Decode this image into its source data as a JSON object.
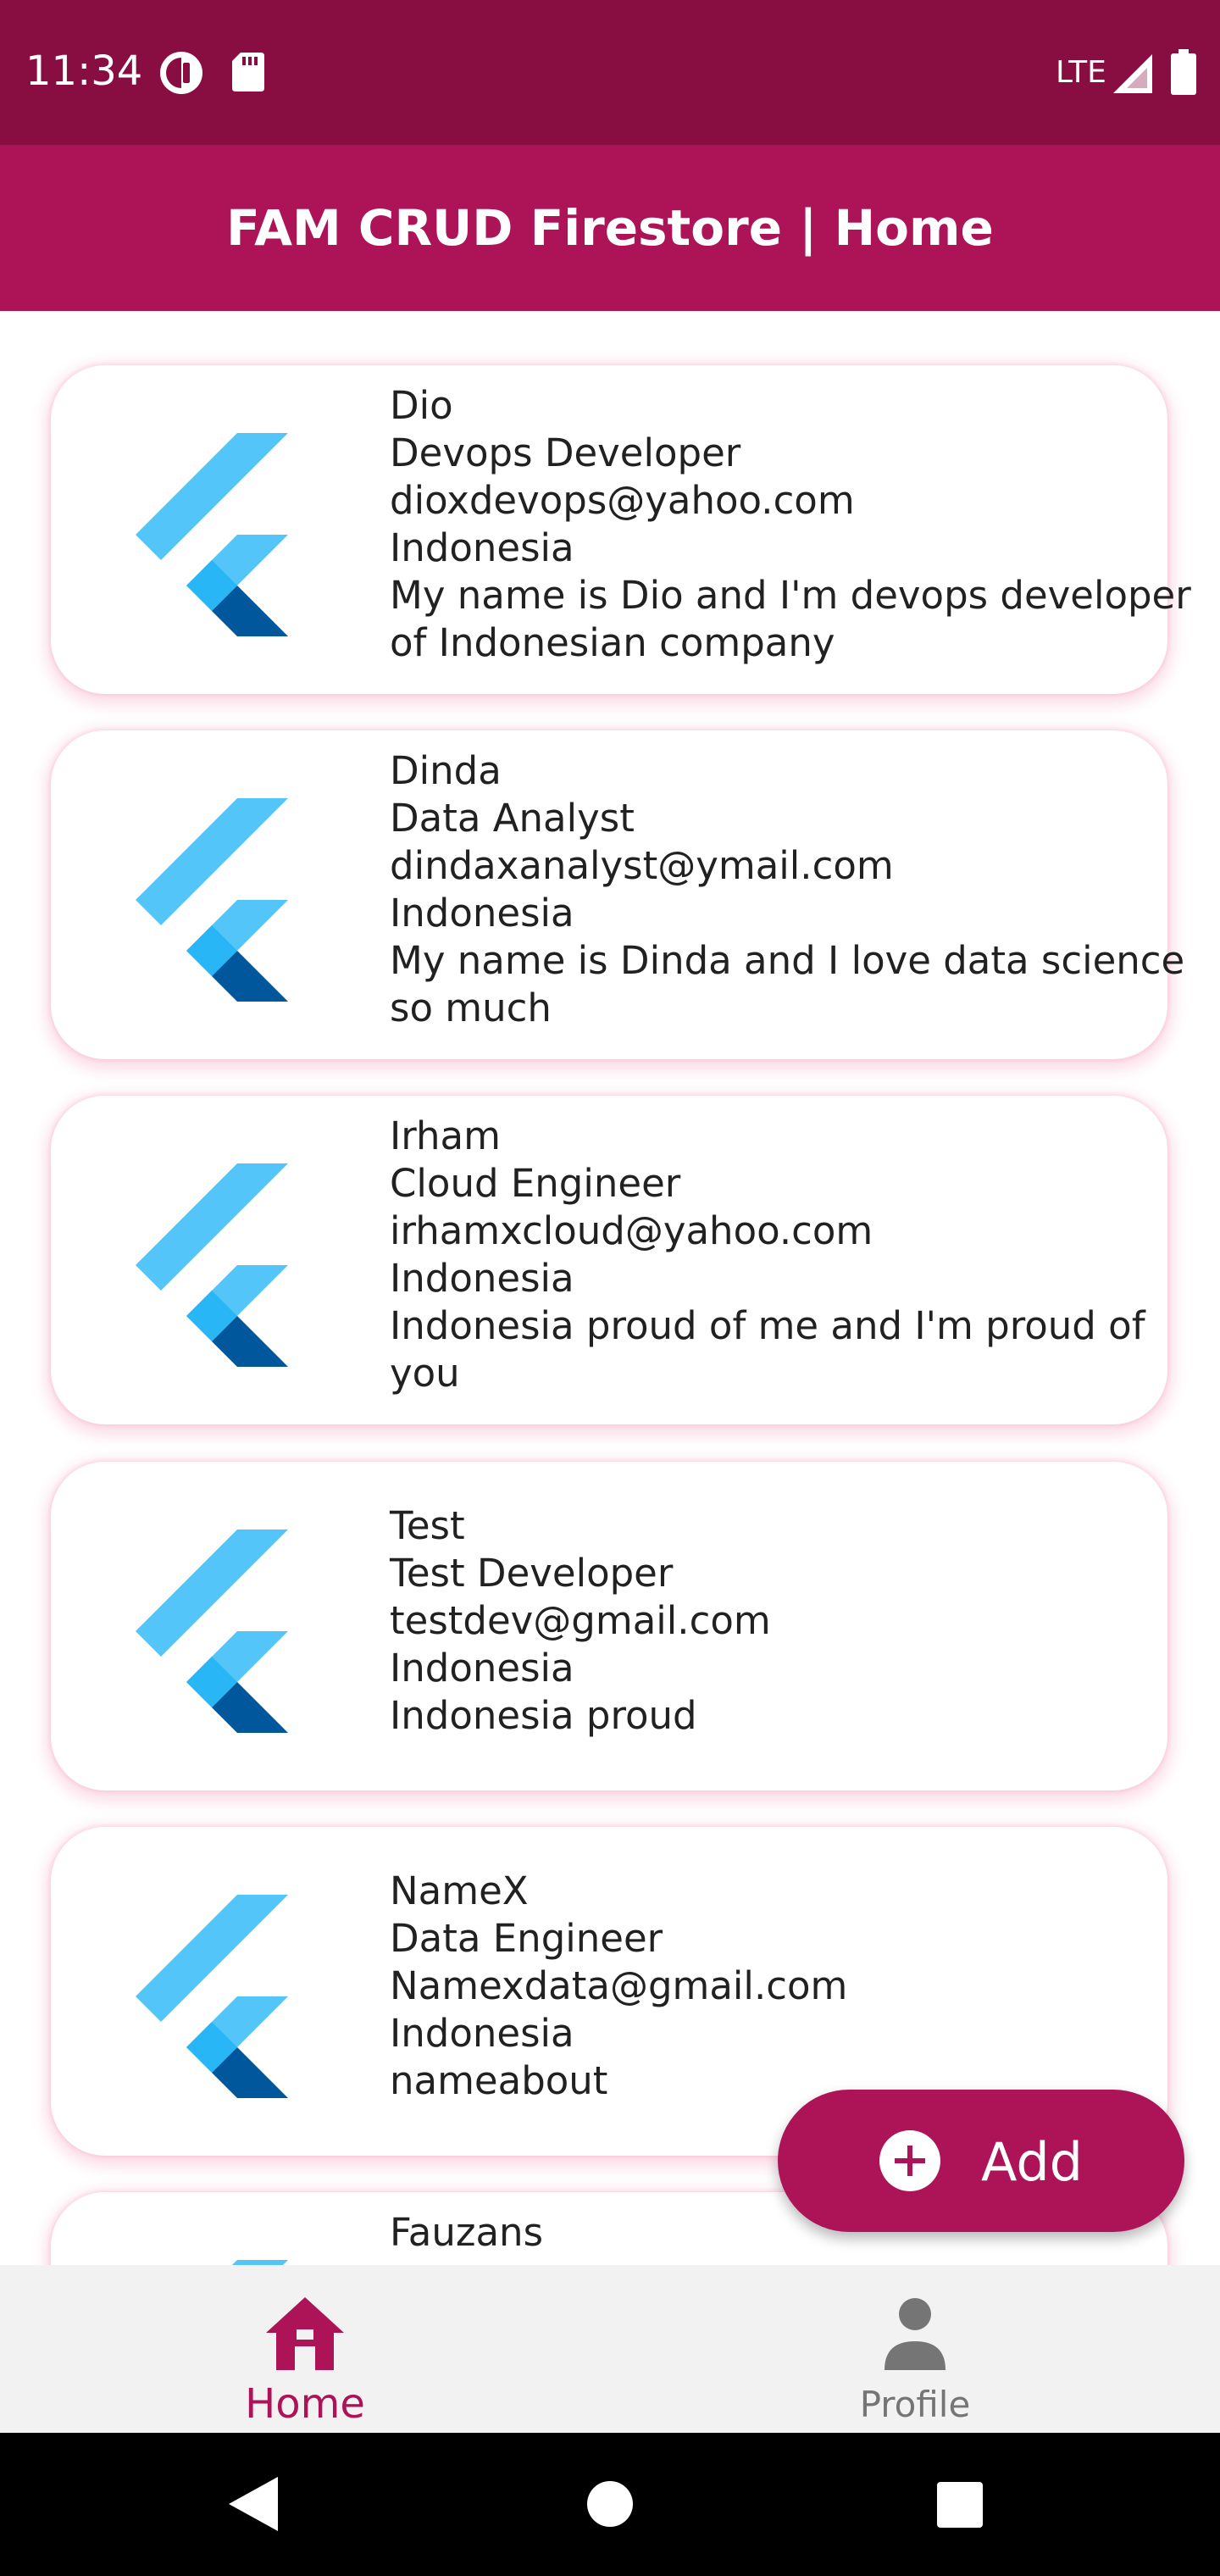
{
  "status_bar": {
    "time": "11:34",
    "network": "LTE",
    "icons": [
      "notification-circle-icon",
      "sd-card-icon",
      "signal-icon",
      "battery-icon"
    ]
  },
  "app_bar": {
    "title": "FAM CRUD Firestore | Home"
  },
  "users": [
    {
      "name": "Dio",
      "role": "Devops Developer",
      "email": "dioxdevops@yahoo.com",
      "country": "Indonesia",
      "about": "My name is Dio and I'm devops developer of Indonesian company",
      "avatar": "flutter-logo-icon"
    },
    {
      "name": "Dinda",
      "role": "Data Analyst",
      "email": "dindaxanalyst@ymail.com",
      "country": "Indonesia",
      "about": "My name is Dinda and I love data science so much",
      "avatar": "flutter-logo-icon"
    },
    {
      "name": "Irham",
      "role": "Cloud Engineer",
      "email": "irhamxcloud@yahoo.com",
      "country": "Indonesia",
      "about": "Indonesia proud of me and I'm proud of you",
      "avatar": "flutter-logo-icon"
    },
    {
      "name": "Test",
      "role": "Test Developer",
      "email": "testdev@gmail.com",
      "country": "Indonesia",
      "about": "Indonesia proud",
      "avatar": "flutter-logo-icon"
    },
    {
      "name": "NameX",
      "role": "Data Engineer",
      "email": "Namexdata@gmail.com",
      "country": "Indonesia",
      "about": "nameabout",
      "avatar": "flutter-logo-icon"
    },
    {
      "name": "Fauzans",
      "avatar": "flutter-logo-icon"
    }
  ],
  "fab": {
    "label": "Add",
    "icon": "add-circle-icon"
  },
  "bottom_nav": {
    "items": [
      {
        "label": "Home",
        "icon": "home-icon",
        "active": true
      },
      {
        "label": "Profile",
        "icon": "person-icon",
        "active": false
      }
    ]
  },
  "system_nav": {
    "icons": [
      "back-icon",
      "home-circle-icon",
      "recents-icon"
    ]
  },
  "colors": {
    "status_bar": "#880e41",
    "app_bar": "#ad1457",
    "accent": "#ad1457",
    "nav_inactive": "#757575",
    "nav_background": "#f2f2f2"
  }
}
